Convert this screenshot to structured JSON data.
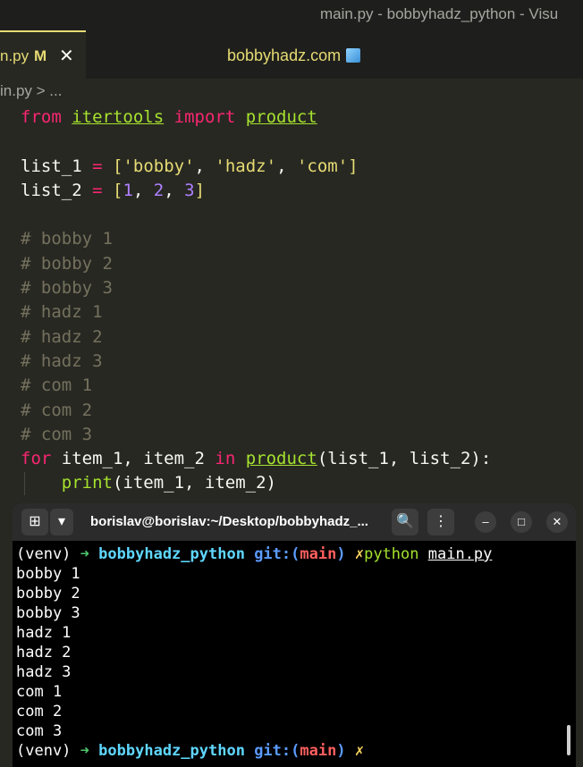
{
  "window": {
    "title": "main.py - bobbyhadz_python - Visu"
  },
  "tab": {
    "filename": "n.py",
    "modified": "M",
    "close": "✕"
  },
  "center_title": "bobbyhadz.com",
  "breadcrumb": "in.py > ...",
  "code": {
    "l1": {
      "from": "from",
      "module": "itertools",
      "import": "import",
      "name": "product"
    },
    "l3": {
      "var": "list_1",
      "eq": "=",
      "lb": "[",
      "s1": "'bobby'",
      "c1": ", ",
      "s2": "'hadz'",
      "c2": ", ",
      "s3": "'com'",
      "rb": "]"
    },
    "l4": {
      "var": "list_2",
      "eq": "=",
      "lb": "[",
      "n1": "1",
      "c1": ", ",
      "n2": "2",
      "c2": ", ",
      "n3": "3",
      "rb": "]"
    },
    "comments": [
      "# bobby 1",
      "# bobby 2",
      "# bobby 3",
      "# hadz 1",
      "# hadz 2",
      "# hadz 3",
      "# com 1",
      "# com 2",
      "# com 3"
    ],
    "l15": {
      "for": "for",
      "vars": "item_1, item_2",
      "in": "in",
      "func": "product",
      "args": "(list_1, list_2):"
    },
    "l16": {
      "print": "print",
      "args": "(item_1, item_2)"
    }
  },
  "terminal": {
    "title": "borislav@borislav:~/Desktop/bobbyhadz_...",
    "prompt": {
      "venv": "(venv)",
      "arrow": "➜",
      "project": "bobbyhadz_python",
      "git": "git:(",
      "branch": "main",
      "git_close": ")",
      "dirty": "✗",
      "cmd": "python",
      "arg": "main.py"
    },
    "output": [
      "bobby 1",
      "bobby 2",
      "bobby 3",
      "hadz 1",
      "hadz 2",
      "hadz 3",
      "com 1",
      "com 2",
      "com 3"
    ]
  },
  "colors": {
    "editor_bg": "#272822",
    "keyword": "#f92672",
    "function": "#a6e22e",
    "string": "#e6db74",
    "number": "#ae81ff",
    "comment": "#75715e"
  }
}
